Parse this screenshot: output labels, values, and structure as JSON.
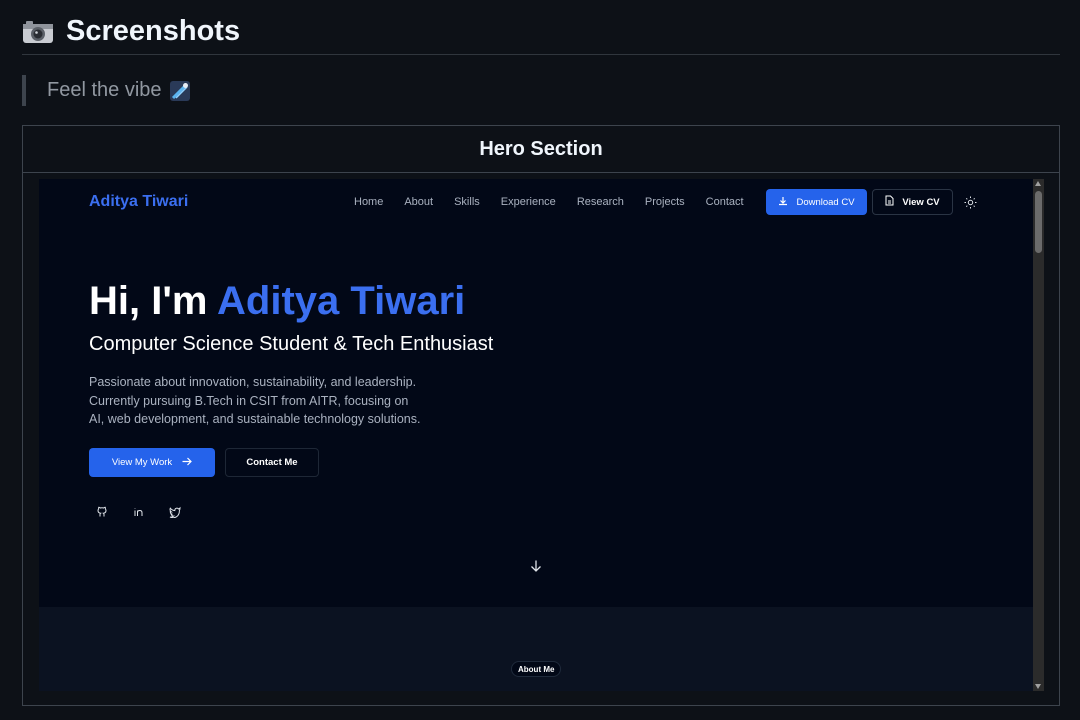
{
  "heading": {
    "title": "Screenshots",
    "icon": "camera-icon"
  },
  "quote": {
    "text": "Feel the vibe",
    "icon": "meteor-icon"
  },
  "table": {
    "header": "Hero Section"
  },
  "site": {
    "brand": "Aditya Tiwari",
    "nav": [
      "Home",
      "About",
      "Skills",
      "Experience",
      "Research",
      "Projects",
      "Contact"
    ],
    "download_cv": "Download CV",
    "view_cv": "View CV",
    "theme_icon": "sun-icon",
    "hero": {
      "greeting": "Hi, I'm ",
      "name": "Aditya Tiwari",
      "subtitle": "Computer Science Student & Tech Enthusiast",
      "desc_lines": [
        "Passionate about innovation, sustainability, and leadership.",
        "Currently pursuing B.Tech in CSIT from AITR, focusing on",
        "AI, web development, and sustainable technology solutions."
      ],
      "view_work": "View My Work",
      "contact_me": "Contact Me",
      "socials": [
        "github-icon",
        "linkedin-icon",
        "twitter-icon"
      ]
    },
    "about_pill": "About Me"
  },
  "colors": {
    "accent": "#2563eb",
    "brand": "#3b6ff0",
    "page_bg": "#0d1117",
    "site_bg": "#020817"
  }
}
